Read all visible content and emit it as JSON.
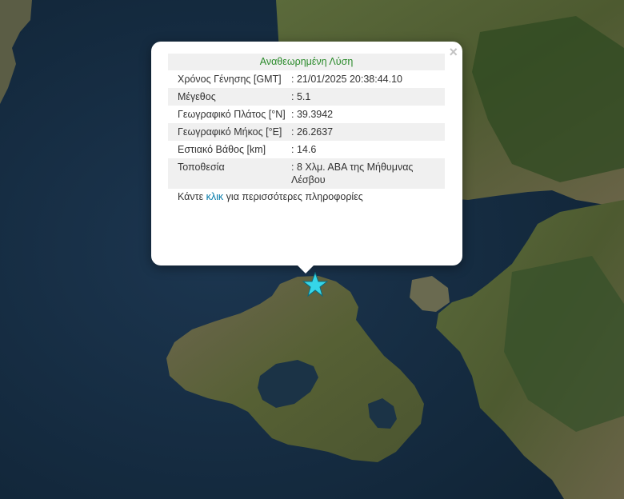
{
  "popup": {
    "title": "Αναθεωρημένη Λύση",
    "close_icon": "×",
    "rows": [
      {
        "label": "Χρόνος Γένησης [GMT]",
        "value": ": 21/01/2025 20:38:44.10"
      },
      {
        "label": "Μέγεθος",
        "value": ": 5.1"
      },
      {
        "label": "Γεωγραφικό Πλάτος [°N]",
        "value": ": 39.3942"
      },
      {
        "label": "Γεωγραφικό Μήκος [°E]",
        "value": ": 26.2637"
      },
      {
        "label": "Εστιακό Βάθος [km]",
        "value": ": 14.6"
      },
      {
        "label": "Τοποθεσία",
        "value": ": 8 Χλμ. ΑΒΑ της Μήθυμνας Λέσβου"
      }
    ],
    "more_prefix": "Κάντε ",
    "more_link": "κλικ",
    "more_suffix": " για περισσότερες πληροφορίες"
  },
  "map": {
    "marker_icon": "star-icon",
    "marker_color": "#35d6e8",
    "sea_color": "#142a3c",
    "land_color": "#4f5d33"
  }
}
